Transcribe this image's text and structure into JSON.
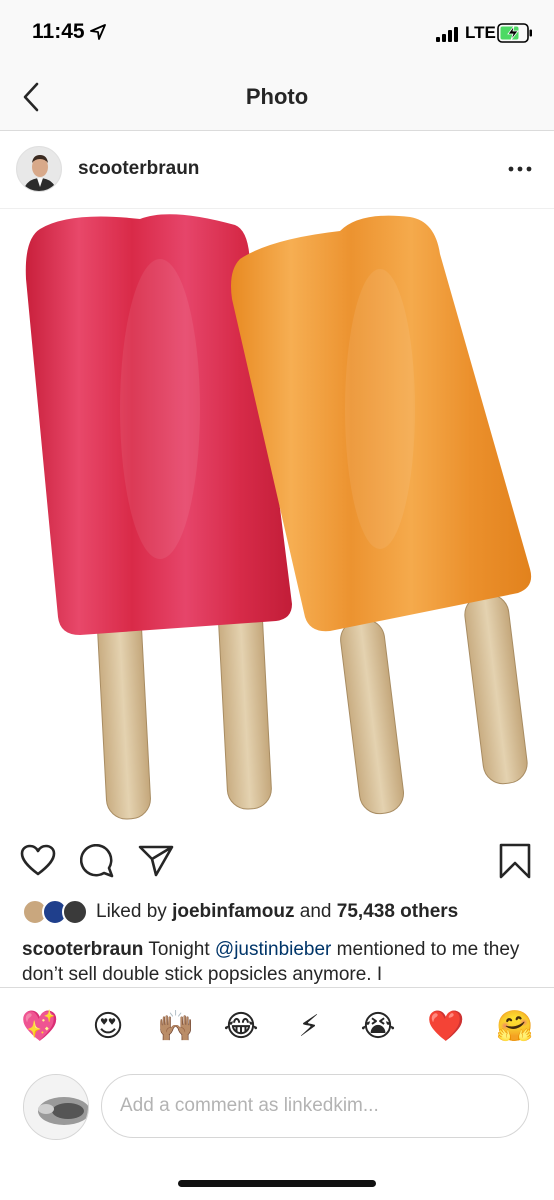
{
  "status": {
    "time": "11:45",
    "network": "LTE",
    "location_icon": "location-arrow-icon",
    "signal_icon": "signal-bars-icon",
    "battery_icon": "battery-charging-icon"
  },
  "nav": {
    "title": "Photo",
    "back_icon": "chevron-left-icon"
  },
  "post": {
    "username": "scooterbraun",
    "more_icon": "ellipsis-icon",
    "photo_subject": "red-orange-double-stick-popsicles"
  },
  "actions": {
    "like_icon": "heart-icon",
    "comment_icon": "comment-bubble-icon",
    "share_icon": "paper-plane-icon",
    "save_icon": "bookmark-icon"
  },
  "likes": {
    "prefix": "Liked by",
    "user": "joebinfamouz",
    "middle": "and",
    "count": "75,438 others"
  },
  "caption": {
    "user": "scooterbraun",
    "text_before": "Tonight",
    "mention": "@justinbieber",
    "text_after": "mentioned to me they don’t sell double stick popsicles anymore. I"
  },
  "emoji_bar": [
    "💖",
    "😍",
    "🙌🏽",
    "😂",
    "⚡",
    "😭",
    "❤️",
    "🤗"
  ],
  "comment": {
    "placeholder": "Add a comment as linkedkim..."
  },
  "colors": {
    "text": "#262626",
    "mention": "#003569",
    "divider": "#dbdbdb",
    "red_popsicle": "#e0344f",
    "orange_popsicle": "#f09a33",
    "stick": "#d9c29c"
  }
}
